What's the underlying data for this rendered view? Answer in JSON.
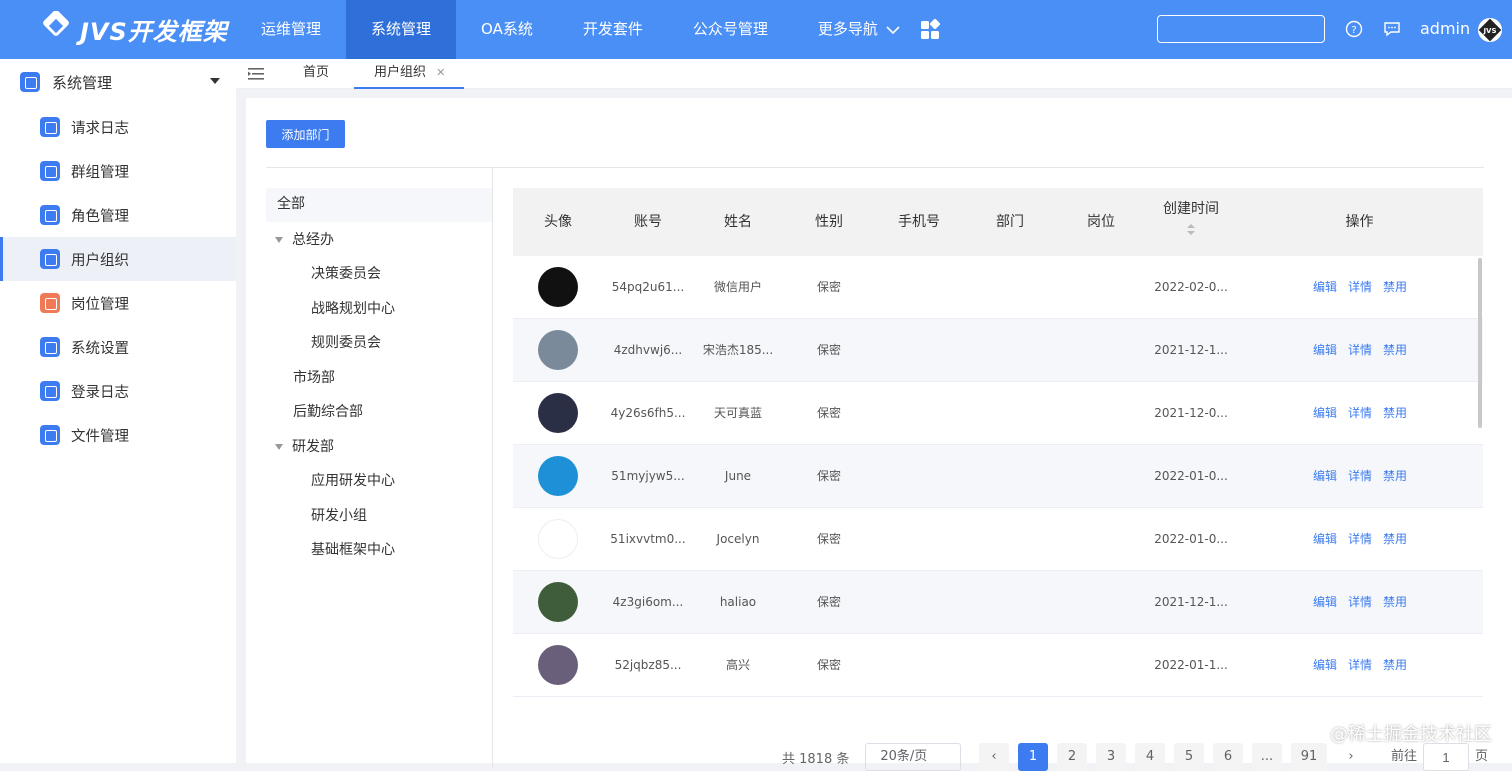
{
  "brand": {
    "logo_text": "JVS开发框架",
    "accent": "#4a8ff5",
    "active": "#2f6fd9",
    "primary": "#3d7cf0"
  },
  "topnav": {
    "items": [
      {
        "label": "运维管理"
      },
      {
        "label": "系统管理"
      },
      {
        "label": "OA系统"
      },
      {
        "label": "开发套件"
      },
      {
        "label": "公众号管理"
      },
      {
        "label": "更多导航"
      }
    ],
    "active_index": 1,
    "user": "admin",
    "search_value": ""
  },
  "sidebar": {
    "header": "系统管理",
    "items": [
      {
        "label": "请求日志",
        "icon": "document-icon"
      },
      {
        "label": "群组管理",
        "icon": "box-icon"
      },
      {
        "label": "角色管理",
        "icon": "id-card-icon"
      },
      {
        "label": "用户组织",
        "icon": "check-clipboard-icon"
      },
      {
        "label": "岗位管理",
        "icon": "gear-icon"
      },
      {
        "label": "系统设置",
        "icon": "chart-icon"
      },
      {
        "label": "登录日志",
        "icon": "document-icon"
      },
      {
        "label": "文件管理",
        "icon": "folder-icon"
      }
    ],
    "active_index": 3
  },
  "tabs": {
    "items": [
      {
        "label": "首页"
      },
      {
        "label": "用户组织"
      }
    ],
    "active_index": 1
  },
  "toolbar": {
    "add_dept": "添加部门"
  },
  "tree": {
    "all": "全部",
    "nodes": [
      {
        "label": "总经办",
        "expanded": true,
        "level": 0
      },
      {
        "label": "决策委员会",
        "level": 1
      },
      {
        "label": "战略规划中心",
        "level": 1
      },
      {
        "label": "规则委员会",
        "level": 1
      },
      {
        "label": "市场部",
        "level": 0
      },
      {
        "label": "后勤综合部",
        "level": 0
      },
      {
        "label": "研发部",
        "expanded": true,
        "level": 0
      },
      {
        "label": "应用研发中心",
        "level": 1
      },
      {
        "label": "研发小组",
        "level": 1
      },
      {
        "label": "基础框架中心",
        "level": 1
      }
    ]
  },
  "table": {
    "columns": [
      "头像",
      "账号",
      "姓名",
      "性别",
      "手机号",
      "部门",
      "岗位",
      "创建时间",
      "操作"
    ],
    "actions": [
      "编辑",
      "详情",
      "禁用"
    ],
    "rows": [
      {
        "account": "54pq2u61...",
        "name": "微信用户",
        "gender": "保密",
        "phone": "",
        "dept": "",
        "post": "",
        "created": "2022-02-0..."
      },
      {
        "account": "4zdhvwj6...",
        "name": "宋浩杰185...",
        "gender": "保密",
        "phone": "",
        "dept": "",
        "post": "",
        "created": "2021-12-1..."
      },
      {
        "account": "4y26s6fh5...",
        "name": "天可真蓝",
        "gender": "保密",
        "phone": "",
        "dept": "",
        "post": "",
        "created": "2021-12-0..."
      },
      {
        "account": "51myjyw5...",
        "name": "June",
        "gender": "保密",
        "phone": "",
        "dept": "",
        "post": "",
        "created": "2022-01-0..."
      },
      {
        "account": "51ixvvtm0...",
        "name": "Jocelyn",
        "gender": "保密",
        "phone": "",
        "dept": "",
        "post": "",
        "created": "2022-01-0..."
      },
      {
        "account": "4z3gi6om...",
        "name": "haliao",
        "gender": "保密",
        "phone": "",
        "dept": "",
        "post": "",
        "created": "2021-12-1..."
      },
      {
        "account": "52jqbz85...",
        "name": "高兴",
        "gender": "保密",
        "phone": "",
        "dept": "",
        "post": "",
        "created": "2022-01-1..."
      }
    ]
  },
  "pagination": {
    "total_text": "共 1818 条",
    "page_size": "20条/页",
    "pages": [
      "1",
      "2",
      "3",
      "4",
      "5",
      "6",
      "...",
      "91"
    ],
    "current": "1",
    "goto_label": "前往",
    "goto_value": "1",
    "page_unit": "页"
  },
  "watermark": "@稀土掘金技术社区"
}
